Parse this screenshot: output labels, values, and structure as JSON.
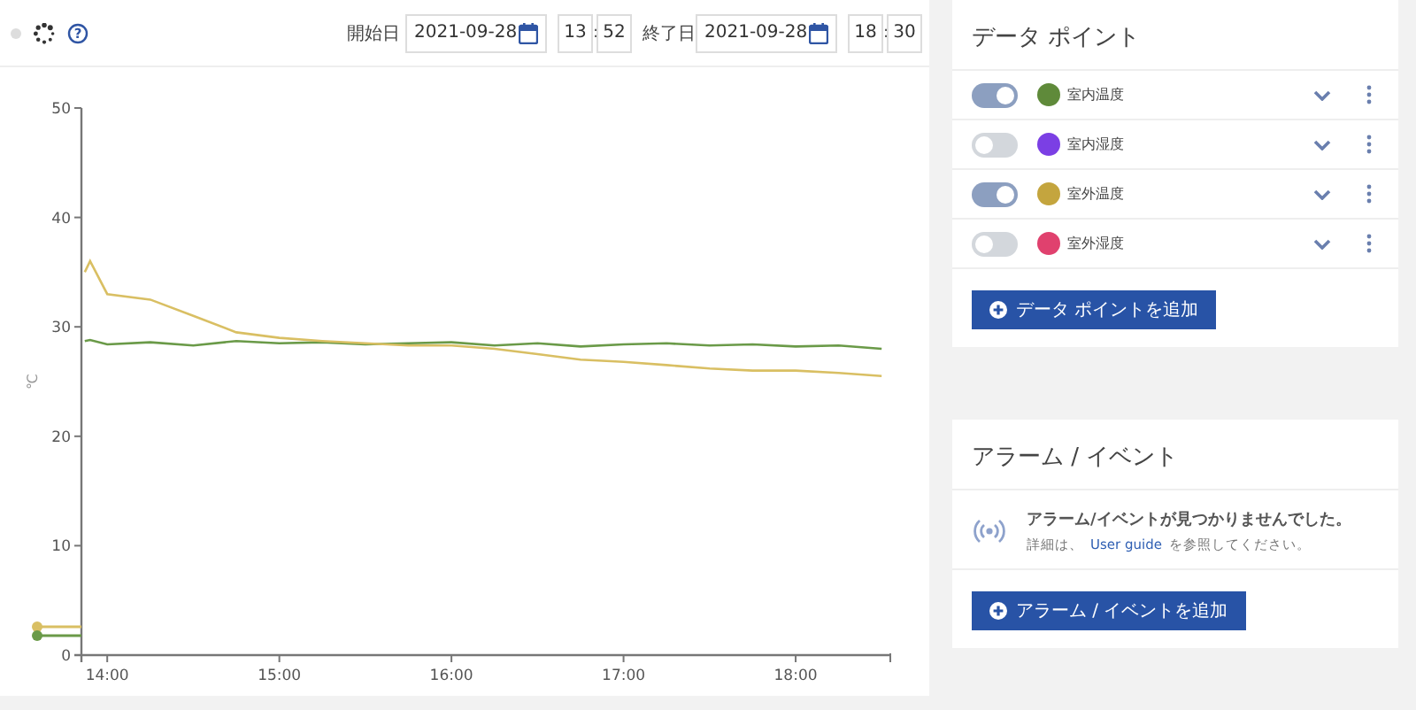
{
  "toolbar": {
    "help": "?",
    "start_label": "開始日",
    "start_date": "2021-09-28",
    "start_hour": "13",
    "start_minute": "52",
    "time_separator_1": ":",
    "end_label": "終了日",
    "end_date": "2021-09-28",
    "end_hour": "18",
    "end_minute": "30",
    "time_separator_2": ":"
  },
  "chart": {
    "chart_data": {
      "type": "line",
      "ylabel": "℃",
      "x": [
        13.87,
        13.9,
        14,
        14.25,
        14.5,
        14.75,
        15,
        15.25,
        15.5,
        15.75,
        16,
        16.25,
        16.5,
        16.75,
        17,
        17.25,
        17.5,
        17.75,
        18,
        18.25,
        18.5
      ],
      "series": [
        {
          "color": "#6a9a48",
          "values": [
            28.7,
            28.8,
            28.4,
            28.6,
            28.3,
            28.7,
            28.5,
            28.6,
            28.4,
            28.5,
            28.6,
            28.3,
            28.5,
            28.2,
            28.4,
            28.5,
            28.3,
            28.4,
            28.2,
            28.3,
            28.0
          ]
        },
        {
          "color": "#d9bf63",
          "values": [
            35,
            36,
            33,
            32.5,
            31,
            29.5,
            29,
            28.7,
            28.5,
            28.3,
            28.3,
            28,
            27.5,
            27,
            26.8,
            26.5,
            26.2,
            26,
            26,
            25.8,
            25.5
          ]
        }
      ],
      "ylim": [
        0,
        50
      ],
      "xlim": [
        13.85,
        18.55
      ],
      "yticks": [
        0,
        10,
        20,
        30,
        40,
        50
      ],
      "xticks": [
        {
          "value": 14,
          "label": "14:00"
        },
        {
          "value": 15,
          "label": "15:00"
        },
        {
          "value": 16,
          "label": "16:00"
        },
        {
          "value": 17,
          "label": "17:00"
        },
        {
          "value": 18,
          "label": "18:00"
        }
      ]
    }
  },
  "data_points": {
    "title": "データ ポイント",
    "items": [
      {
        "on": true,
        "color": "#5f8a3a",
        "label": "室内温度"
      },
      {
        "on": false,
        "color": "#7b3fe4",
        "label": "室内湿度"
      },
      {
        "on": true,
        "color": "#c4a53e",
        "label": "室外温度"
      },
      {
        "on": false,
        "color": "#e0416e",
        "label": "室外湿度"
      }
    ],
    "add_button": "データ ポイントを追加"
  },
  "alarms": {
    "title": "アラーム / イベント",
    "empty_message": "アラーム/イベントが見つかりませんでした。",
    "hint_before": "詳細は、",
    "hint_link": "User guide",
    "hint_after": "を参照してください。",
    "add_button": "アラーム / イベントを追加"
  }
}
